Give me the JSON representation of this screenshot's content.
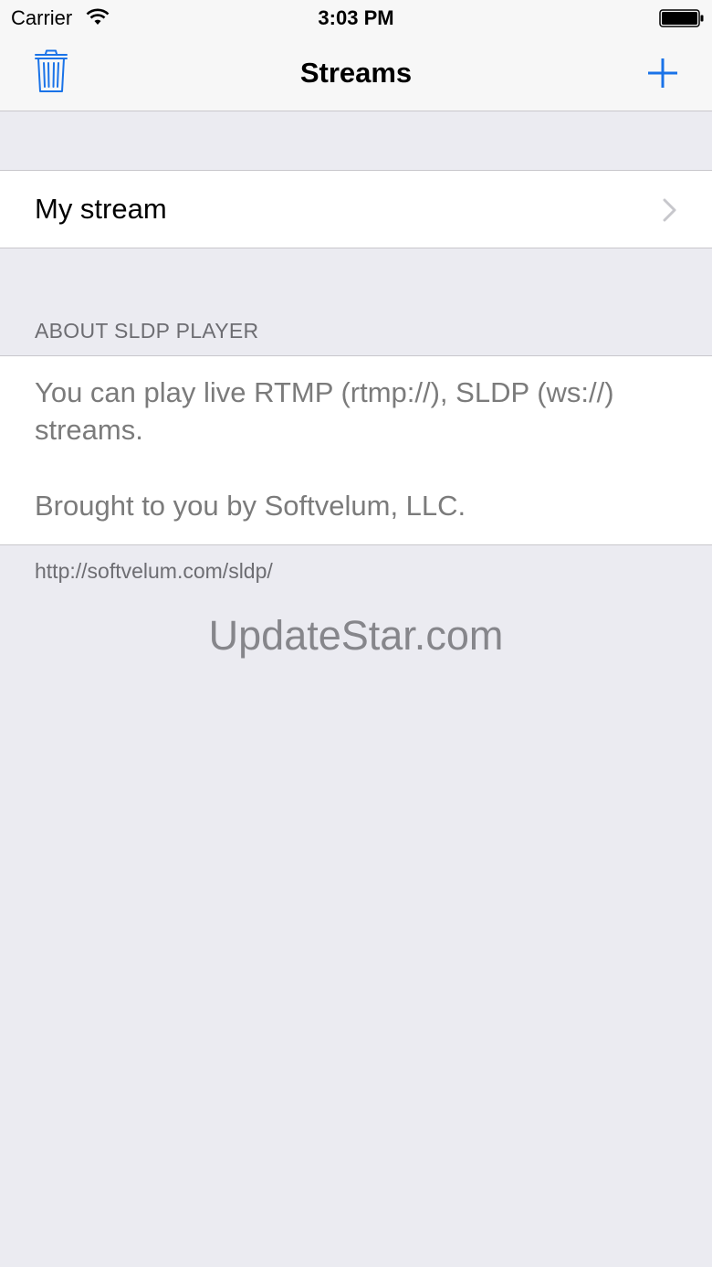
{
  "status_bar": {
    "carrier": "Carrier",
    "time": "3:03 PM"
  },
  "nav_bar": {
    "title": "Streams",
    "left_icon": "trash-icon",
    "right_icon": "plus-icon"
  },
  "streams": {
    "items": [
      {
        "label": "My stream"
      }
    ]
  },
  "about": {
    "header": "ABOUT SLDP PLAYER",
    "line1": "You can play live RTMP (rtmp://), SLDP (ws://)",
    "line2": "streams.",
    "line3": "Brought to you by Softvelum, LLC.",
    "footer": "http://softvelum.com/sldp/"
  },
  "watermark": "UpdateStar.com",
  "colors": {
    "accent": "#1a73e8",
    "background": "#ebebf1",
    "secondary_text": "#6d6d72"
  }
}
